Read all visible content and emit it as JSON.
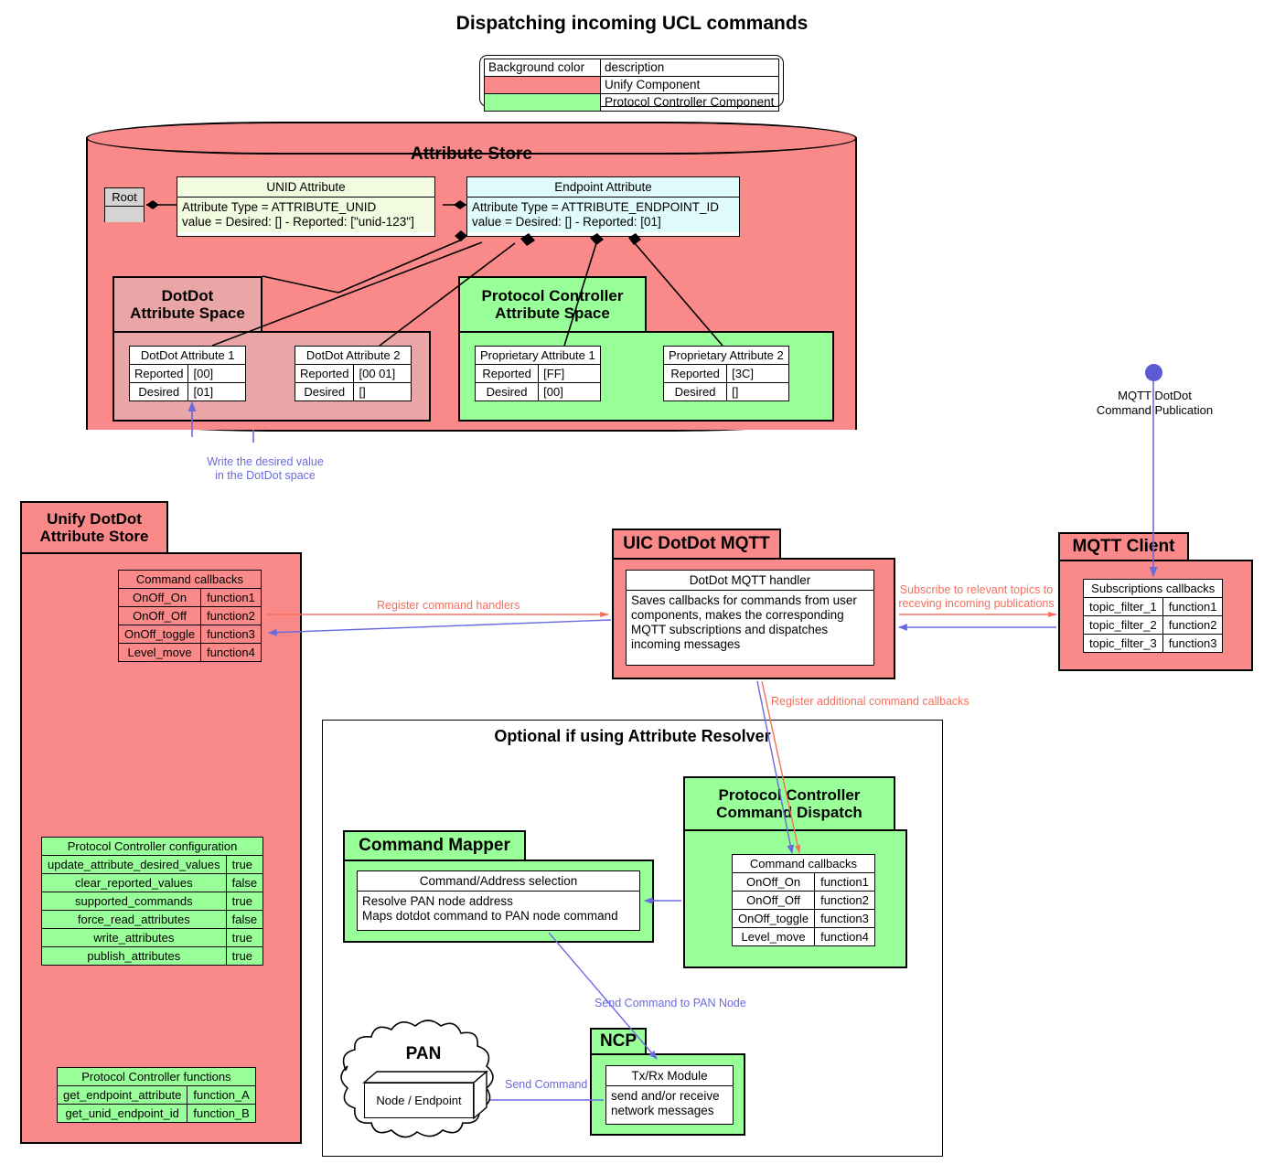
{
  "title": "Dispatching incoming UCL commands",
  "legend": {
    "col_color": "Background color",
    "col_desc": "description",
    "rows": [
      {
        "color": "#fa8a8a",
        "desc": "Unify Component"
      },
      {
        "color": "#99ff99",
        "desc": "Protocol Controller Component"
      }
    ]
  },
  "attribute_store": {
    "title": "Attribute Store",
    "root": "Root",
    "unid_attribute": {
      "name": "UNID Attribute",
      "line1": "Attribute Type = ATTRIBUTE_UNID",
      "line2": "value = Desired: [] - Reported: [\"unid-123\"]"
    },
    "endpoint_attribute": {
      "name": "Endpoint Attribute",
      "line1": "Attribute Type = ATTRIBUTE_ENDPOINT_ID",
      "line2": "value = Desired: [] - Reported: [01]"
    },
    "dotdot_space": {
      "title_line1": "DotDot",
      "title_line2": "Attribute Space",
      "attributes": [
        {
          "name": "DotDot Attribute 1",
          "reported_key": "Reported",
          "reported": "[00]",
          "desired_key": "Desired",
          "desired": "[01]"
        },
        {
          "name": "DotDot Attribute 2",
          "reported_key": "Reported",
          "reported": "[00 01]",
          "desired_key": "Desired",
          "desired": "[]"
        }
      ]
    },
    "pc_space": {
      "title_line1": "Protocol Controller",
      "title_line2": "Attribute Space",
      "attributes": [
        {
          "name": "Proprietary Attribute 1",
          "reported_key": "Reported",
          "reported": "[FF]",
          "desired_key": "Desired",
          "desired": "[00]"
        },
        {
          "name": "Proprietary Attribute 2",
          "reported_key": "Reported",
          "reported": "[3C]",
          "desired_key": "Desired",
          "desired": "[]"
        }
      ]
    }
  },
  "unify_store": {
    "title_line1": "Unify DotDot",
    "title_line2": "Attribute Store",
    "command_callbacks": {
      "header": "Command callbacks",
      "rows": [
        {
          "k": "OnOff_On",
          "v": "function1"
        },
        {
          "k": "OnOff_Off",
          "v": "function2"
        },
        {
          "k": "OnOff_toggle",
          "v": "function3"
        },
        {
          "k": "Level_move",
          "v": "function4"
        }
      ]
    },
    "pc_configuration": {
      "header": "Protocol Controller configuration",
      "rows": [
        {
          "k": "update_attribute_desired_values",
          "v": "true"
        },
        {
          "k": "clear_reported_values",
          "v": "false"
        },
        {
          "k": "supported_commands",
          "v": "true"
        },
        {
          "k": "force_read_attributes",
          "v": "false"
        },
        {
          "k": "write_attributes",
          "v": "true"
        },
        {
          "k": "publish_attributes",
          "v": "true"
        }
      ]
    },
    "pc_functions": {
      "header": "Protocol Controller functions",
      "rows": [
        {
          "k": "get_endpoint_attribute",
          "v": "function_A"
        },
        {
          "k": "get_unid_endpoint_id",
          "v": "function_B"
        }
      ]
    }
  },
  "uic_dotdot_mqtt": {
    "title": "UIC DotDot MQTT",
    "handler": {
      "name": "DotDot MQTT handler",
      "description": "Saves callbacks for commands from user components, makes the corresponding MQTT subscriptions and dispatches incoming messages"
    }
  },
  "mqtt_client": {
    "title": "MQTT Client",
    "publication_label_line1": "MQTT DotDot",
    "publication_label_line2": "Command Publication",
    "subscriptions": {
      "header": "Subscriptions callbacks",
      "rows": [
        {
          "k": "topic_filter_1",
          "v": "function1"
        },
        {
          "k": "topic_filter_2",
          "v": "function2"
        },
        {
          "k": "topic_filter_3",
          "v": "function3"
        }
      ]
    }
  },
  "optional": {
    "title": "Optional if using Attribute Resolver",
    "command_mapper": {
      "title": "Command Mapper",
      "class_name": "Command/Address selection",
      "line1": "Resolve PAN node address",
      "line2": "Maps dotdot command to PAN node command"
    },
    "command_dispatch": {
      "title_line1": "Protocol Controller",
      "title_line2": "Command Dispatch",
      "command_callbacks": {
        "header": "Command callbacks",
        "rows": [
          {
            "k": "OnOff_On",
            "v": "function1"
          },
          {
            "k": "OnOff_Off",
            "v": "function2"
          },
          {
            "k": "OnOff_toggle",
            "v": "function3"
          },
          {
            "k": "Level_move",
            "v": "function4"
          }
        ]
      }
    },
    "ncp": {
      "title": "NCP",
      "module_name": "Tx/Rx Module",
      "line1": "send and/or receive",
      "line2": "network messages"
    },
    "pan": {
      "title": "PAN",
      "node": "Node / Endpoint"
    }
  },
  "connector_labels": {
    "write_desired_line1": "Write the desired value",
    "write_desired_line2": "in the DotDot space",
    "register_command_handlers": "Register command handlers",
    "subscribe_line1": "Subscribe to relevant topics to",
    "subscribe_line2": "receving incoming publications",
    "register_additional": "Register additional command callbacks",
    "send_command_to_pan_node": "Send Command to PAN Node",
    "send_command": "Send Command"
  },
  "colors": {
    "unify": "#fa8a8a",
    "protocol_controller": "#99ff99",
    "blue_arrow": "#6a6ae0",
    "red_arrow": "#f4705e",
    "dotdot_space": "#eaa6a6",
    "unid_attr": "#f2fadf",
    "endpoint_attr": "#e0fbfb"
  }
}
